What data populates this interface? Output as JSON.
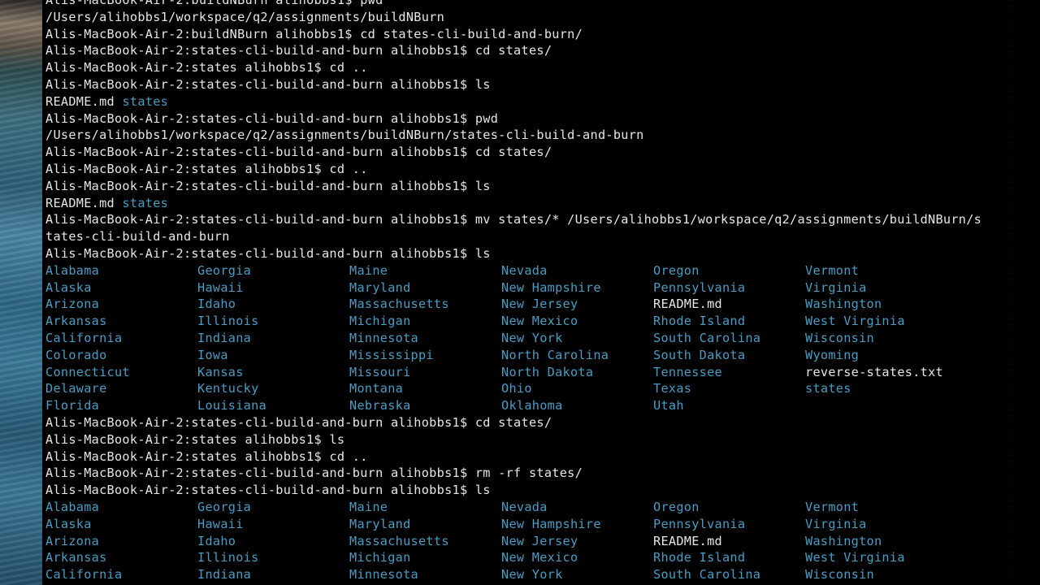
{
  "lines": [
    {
      "kind": "text",
      "text": "Alis-MacBook-Air-2:buildNBurn alihobbs1$ pwd"
    },
    {
      "kind": "text",
      "text": "/Users/alihobbs1/workspace/q2/assignments/buildNBurn"
    },
    {
      "kind": "text",
      "text": "Alis-MacBook-Air-2:buildNBurn alihobbs1$ cd states-cli-build-and-burn/"
    },
    {
      "kind": "text",
      "text": "Alis-MacBook-Air-2:states-cli-build-and-burn alihobbs1$ cd states/"
    },
    {
      "kind": "text",
      "text": "Alis-MacBook-Air-2:states alihobbs1$ cd .."
    },
    {
      "kind": "text",
      "text": "Alis-MacBook-Air-2:states-cli-build-and-burn alihobbs1$ ls"
    },
    {
      "kind": "ls2",
      "file": "README.md",
      "dir": "states"
    },
    {
      "kind": "text",
      "text": "Alis-MacBook-Air-2:states-cli-build-and-burn alihobbs1$ pwd"
    },
    {
      "kind": "text",
      "text": "/Users/alihobbs1/workspace/q2/assignments/buildNBurn/states-cli-build-and-burn"
    },
    {
      "kind": "text",
      "text": "Alis-MacBook-Air-2:states-cli-build-and-burn alihobbs1$ cd states/"
    },
    {
      "kind": "text",
      "text": "Alis-MacBook-Air-2:states alihobbs1$ cd .."
    },
    {
      "kind": "text",
      "text": "Alis-MacBook-Air-2:states-cli-build-and-burn alihobbs1$ ls"
    },
    {
      "kind": "ls2",
      "file": "README.md",
      "dir": "states"
    },
    {
      "kind": "text",
      "text": "Alis-MacBook-Air-2:states-cli-build-and-burn alihobbs1$ mv states/* /Users/alihobbs1/workspace/q2/assignments/buildNBurn/s"
    },
    {
      "kind": "text",
      "text": "tates-cli-build-and-burn"
    },
    {
      "kind": "text",
      "text": "Alis-MacBook-Air-2:states-cli-build-and-burn alihobbs1$ ls"
    },
    {
      "kind": "grid",
      "rows": [
        [
          {
            "t": "Alabama",
            "c": "dir"
          },
          {
            "t": "Georgia",
            "c": "dir"
          },
          {
            "t": "Maine",
            "c": "dir"
          },
          {
            "t": "Nevada",
            "c": "dir"
          },
          {
            "t": "Oregon",
            "c": "dir"
          },
          {
            "t": "Vermont",
            "c": "dir"
          }
        ],
        [
          {
            "t": "Alaska",
            "c": "dir"
          },
          {
            "t": "Hawaii",
            "c": "dir"
          },
          {
            "t": "Maryland",
            "c": "dir"
          },
          {
            "t": "New Hampshire",
            "c": "dir"
          },
          {
            "t": "Pennsylvania",
            "c": "dir"
          },
          {
            "t": "Virginia",
            "c": "dir"
          }
        ],
        [
          {
            "t": "Arizona",
            "c": "dir"
          },
          {
            "t": "Idaho",
            "c": "dir"
          },
          {
            "t": "Massachusetts",
            "c": "dir"
          },
          {
            "t": "New Jersey",
            "c": "dir"
          },
          {
            "t": "README.md",
            "c": "file"
          },
          {
            "t": "Washington",
            "c": "dir"
          }
        ],
        [
          {
            "t": "Arkansas",
            "c": "dir"
          },
          {
            "t": "Illinois",
            "c": "dir"
          },
          {
            "t": "Michigan",
            "c": "dir"
          },
          {
            "t": "New Mexico",
            "c": "dir"
          },
          {
            "t": "Rhode Island",
            "c": "dir"
          },
          {
            "t": "West Virginia",
            "c": "dir"
          }
        ],
        [
          {
            "t": "California",
            "c": "dir"
          },
          {
            "t": "Indiana",
            "c": "dir"
          },
          {
            "t": "Minnesota",
            "c": "dir"
          },
          {
            "t": "New York",
            "c": "dir"
          },
          {
            "t": "South Carolina",
            "c": "dir"
          },
          {
            "t": "Wisconsin",
            "c": "dir"
          }
        ],
        [
          {
            "t": "Colorado",
            "c": "dir"
          },
          {
            "t": "Iowa",
            "c": "dir"
          },
          {
            "t": "Mississippi",
            "c": "dir"
          },
          {
            "t": "North Carolina",
            "c": "dir"
          },
          {
            "t": "South Dakota",
            "c": "dir"
          },
          {
            "t": "Wyoming",
            "c": "dir"
          }
        ],
        [
          {
            "t": "Connecticut",
            "c": "dir"
          },
          {
            "t": "Kansas",
            "c": "dir"
          },
          {
            "t": "Missouri",
            "c": "dir"
          },
          {
            "t": "North Dakota",
            "c": "dir"
          },
          {
            "t": "Tennessee",
            "c": "dir"
          },
          {
            "t": "reverse-states.txt",
            "c": "file"
          }
        ],
        [
          {
            "t": "Delaware",
            "c": "dir"
          },
          {
            "t": "Kentucky",
            "c": "dir"
          },
          {
            "t": "Montana",
            "c": "dir"
          },
          {
            "t": "Ohio",
            "c": "dir"
          },
          {
            "t": "Texas",
            "c": "dir"
          },
          {
            "t": "states",
            "c": "dir"
          }
        ],
        [
          {
            "t": "Florida",
            "c": "dir"
          },
          {
            "t": "Louisiana",
            "c": "dir"
          },
          {
            "t": "Nebraska",
            "c": "dir"
          },
          {
            "t": "Oklahoma",
            "c": "dir"
          },
          {
            "t": "Utah",
            "c": "dir"
          },
          {
            "t": "",
            "c": "dir"
          }
        ]
      ]
    },
    {
      "kind": "text",
      "text": "Alis-MacBook-Air-2:states-cli-build-and-burn alihobbs1$ cd states/"
    },
    {
      "kind": "text",
      "text": "Alis-MacBook-Air-2:states alihobbs1$ ls"
    },
    {
      "kind": "text",
      "text": "Alis-MacBook-Air-2:states alihobbs1$ cd .."
    },
    {
      "kind": "text",
      "text": "Alis-MacBook-Air-2:states-cli-build-and-burn alihobbs1$ rm -rf states/"
    },
    {
      "kind": "text",
      "text": "Alis-MacBook-Air-2:states-cli-build-and-burn alihobbs1$ ls"
    },
    {
      "kind": "grid",
      "rows": [
        [
          {
            "t": "Alabama",
            "c": "dir"
          },
          {
            "t": "Georgia",
            "c": "dir"
          },
          {
            "t": "Maine",
            "c": "dir"
          },
          {
            "t": "Nevada",
            "c": "dir"
          },
          {
            "t": "Oregon",
            "c": "dir"
          },
          {
            "t": "Vermont",
            "c": "dir"
          }
        ],
        [
          {
            "t": "Alaska",
            "c": "dir"
          },
          {
            "t": "Hawaii",
            "c": "dir"
          },
          {
            "t": "Maryland",
            "c": "dir"
          },
          {
            "t": "New Hampshire",
            "c": "dir"
          },
          {
            "t": "Pennsylvania",
            "c": "dir"
          },
          {
            "t": "Virginia",
            "c": "dir"
          }
        ],
        [
          {
            "t": "Arizona",
            "c": "dir"
          },
          {
            "t": "Idaho",
            "c": "dir"
          },
          {
            "t": "Massachusetts",
            "c": "dir"
          },
          {
            "t": "New Jersey",
            "c": "dir"
          },
          {
            "t": "README.md",
            "c": "file"
          },
          {
            "t": "Washington",
            "c": "dir"
          }
        ],
        [
          {
            "t": "Arkansas",
            "c": "dir"
          },
          {
            "t": "Illinois",
            "c": "dir"
          },
          {
            "t": "Michigan",
            "c": "dir"
          },
          {
            "t": "New Mexico",
            "c": "dir"
          },
          {
            "t": "Rhode Island",
            "c": "dir"
          },
          {
            "t": "West Virginia",
            "c": "dir"
          }
        ],
        [
          {
            "t": "California",
            "c": "dir"
          },
          {
            "t": "Indiana",
            "c": "dir"
          },
          {
            "t": "Minnesota",
            "c": "dir"
          },
          {
            "t": "New York",
            "c": "dir"
          },
          {
            "t": "South Carolina",
            "c": "dir"
          },
          {
            "t": "Wisconsin",
            "c": "dir"
          }
        ]
      ]
    }
  ]
}
